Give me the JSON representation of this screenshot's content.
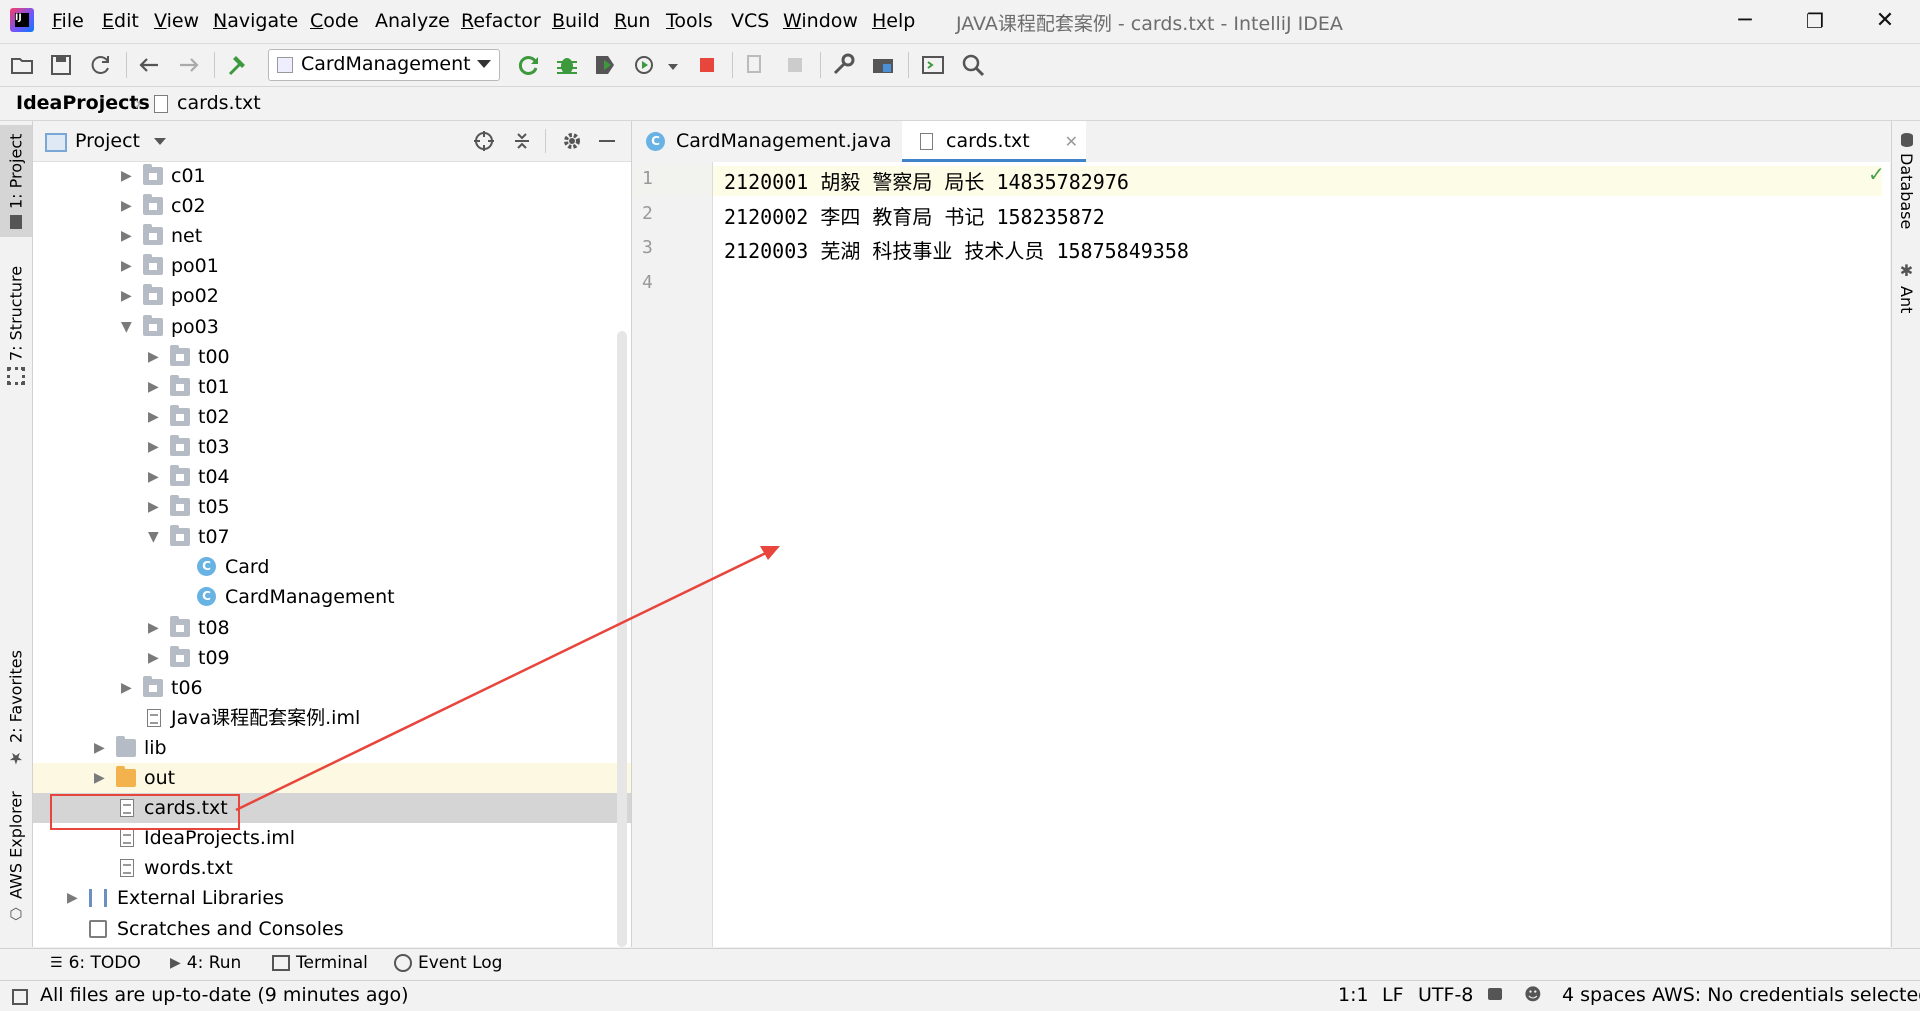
{
  "window": {
    "title": "JAVA课程配套案例 - cards.txt - IntelliJ IDEA",
    "menu": [
      {
        "label": "File",
        "u": "F",
        "rest": "ile"
      },
      {
        "label": "Edit",
        "u": "E",
        "rest": "dit"
      },
      {
        "label": "View",
        "u": "V",
        "rest": "iew"
      },
      {
        "label": "Navigate",
        "u": "N",
        "rest": "avigate"
      },
      {
        "label": "Code",
        "u": "C",
        "rest": "ode"
      },
      {
        "label": "Analyze",
        "u": "",
        "rest": "Analyze"
      },
      {
        "label": "Refactor",
        "u": "R",
        "rest": "efactor"
      },
      {
        "label": "Build",
        "u": "B",
        "rest": "uild"
      },
      {
        "label": "Run",
        "u": "R",
        "rest": "un"
      },
      {
        "label": "Tools",
        "u": "T",
        "rest": "ools"
      },
      {
        "label": "VCS",
        "u": "",
        "rest": "VCS"
      },
      {
        "label": "Window",
        "u": "W",
        "rest": "indow"
      },
      {
        "label": "Help",
        "u": "H",
        "rest": "elp"
      }
    ],
    "controls": {
      "minimize": "─",
      "restore": "❐",
      "close": "✕"
    }
  },
  "toolbar": {
    "run_config": "CardManagement"
  },
  "breadcrumb": {
    "project": "IdeaProjects",
    "file": "cards.txt"
  },
  "left_stripe": {
    "project_tab": "1: Project",
    "structure_tab": "7: Structure",
    "favorites_tab": "2: Favorites",
    "aws_tab": "AWS Explorer"
  },
  "project_panel": {
    "title": "Project",
    "tree": [
      {
        "label": "c01",
        "indent": 0,
        "arrow": "right",
        "icon": "folder"
      },
      {
        "label": "c02",
        "indent": 0,
        "arrow": "right",
        "icon": "folder"
      },
      {
        "label": "net",
        "indent": 0,
        "arrow": "right",
        "icon": "folder"
      },
      {
        "label": "po01",
        "indent": 0,
        "arrow": "right",
        "icon": "folder"
      },
      {
        "label": "po02",
        "indent": 0,
        "arrow": "right",
        "icon": "folder"
      },
      {
        "label": "po03",
        "indent": 0,
        "arrow": "down",
        "icon": "folder"
      },
      {
        "label": "t00",
        "indent": 1,
        "arrow": "right",
        "icon": "folder"
      },
      {
        "label": "t01",
        "indent": 1,
        "arrow": "right",
        "icon": "folder"
      },
      {
        "label": "t02",
        "indent": 1,
        "arrow": "right",
        "icon": "folder"
      },
      {
        "label": "t03",
        "indent": 1,
        "arrow": "right",
        "icon": "folder"
      },
      {
        "label": "t04",
        "indent": 1,
        "arrow": "right",
        "icon": "folder"
      },
      {
        "label": "t05",
        "indent": 1,
        "arrow": "right",
        "icon": "folder"
      },
      {
        "label": "t07",
        "indent": 1,
        "arrow": "down",
        "icon": "folder"
      },
      {
        "label": "Card",
        "indent": 2,
        "arrow": "",
        "icon": "class"
      },
      {
        "label": "CardManagement",
        "indent": 2,
        "arrow": "",
        "icon": "class-run"
      },
      {
        "label": "t08",
        "indent": 1,
        "arrow": "right",
        "icon": "folder"
      },
      {
        "label": "t09",
        "indent": 1,
        "arrow": "right",
        "icon": "folder"
      },
      {
        "label": "t06",
        "indent": 0,
        "arrow": "right",
        "icon": "folder"
      },
      {
        "label": "Java课程配套案例.iml",
        "indent": 0,
        "arrow": "",
        "icon": "iml"
      },
      {
        "label": "lib",
        "indent": -1,
        "arrow": "right",
        "icon": "folder-plain"
      },
      {
        "label": "out",
        "indent": -1,
        "arrow": "right",
        "icon": "folder-orange"
      },
      {
        "label": "cards.txt",
        "indent": -1,
        "arrow": "",
        "icon": "text-file"
      },
      {
        "label": "IdeaProjects.iml",
        "indent": -1,
        "arrow": "",
        "icon": "iml"
      },
      {
        "label": "words.txt",
        "indent": -1,
        "arrow": "",
        "icon": "text-file"
      },
      {
        "label": "External Libraries",
        "indent": -2,
        "arrow": "right",
        "icon": "libraries"
      },
      {
        "label": "Scratches and Consoles",
        "indent": -2,
        "arrow": "",
        "icon": "scratches"
      }
    ],
    "selected": "cards.txt"
  },
  "editor": {
    "tabs": [
      {
        "label": "CardManagement.java",
        "icon": "class-run",
        "active": false
      },
      {
        "label": "cards.txt",
        "icon": "text-file",
        "active": true
      }
    ],
    "line_numbers": [
      "1",
      "2",
      "3",
      "4"
    ],
    "lines": [
      "2120001 胡毅 警察局 局长 14835782976",
      "2120002 李四 教育局 书记 158235872",
      "2120003 芜湖 科技事业 技术人员 15875849358",
      ""
    ]
  },
  "right_stripe": {
    "database_tab": "Database",
    "ant_tab": "Ant"
  },
  "bottom_tools": {
    "todo": "6: TODO",
    "run": "4: Run",
    "terminal": "Terminal",
    "event_log": "Event Log"
  },
  "status": {
    "message": "All files are up-to-date (9 minutes ago)",
    "position": "1:1",
    "line_sep": "LF",
    "encoding": "UTF-8",
    "indent": "4 spaces",
    "aws": "AWS: No credentials selected"
  },
  "colors": {
    "accent_red": "#e8453c",
    "selection": "#d5d5d5",
    "current_line": "#fdfce6"
  }
}
